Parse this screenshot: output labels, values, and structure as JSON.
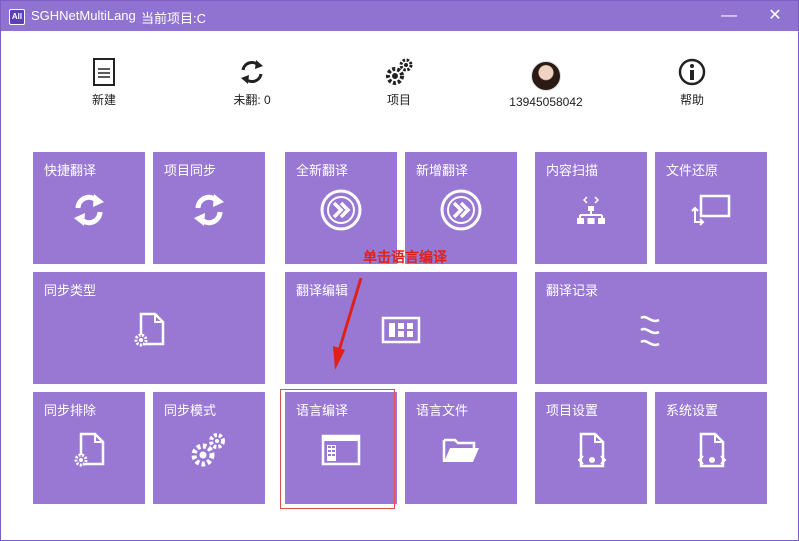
{
  "window": {
    "title": "SGHNetMultiLang",
    "project": "当前项目:C",
    "app_icon_text": "All",
    "minimize_glyph": "—",
    "close_glyph": "✕"
  },
  "toolbar": [
    {
      "label": "新建",
      "icon": "document-icon"
    },
    {
      "label": "未翻: 0",
      "icon": "refresh-icon"
    },
    {
      "label": "项目",
      "icon": "gears-icon"
    },
    {
      "label": "13945058042",
      "icon": "avatar"
    },
    {
      "label": "帮助",
      "icon": "info-icon"
    }
  ],
  "tiles": {
    "quick_translate": "快捷翻译",
    "project_sync": "项目同步",
    "full_translate": "全新翻译",
    "incremental_translate": "新增翻译",
    "content_scan": "内容扫描",
    "file_restore": "文件还原",
    "sync_type": "同步类型",
    "translate_edit": "翻译编辑",
    "translate_record": "翻译记录",
    "sync_exclude": "同步排除",
    "sync_mode": "同步模式",
    "language_edit": "语言编译",
    "language_file": "语言文件",
    "project_settings": "项目设置",
    "system_settings": "系统设置"
  },
  "annotation": {
    "text": "单击语言编译"
  },
  "colors": {
    "titlebar": "#9073d0",
    "tile": "#9878d3",
    "annotation": "#e0211a"
  }
}
